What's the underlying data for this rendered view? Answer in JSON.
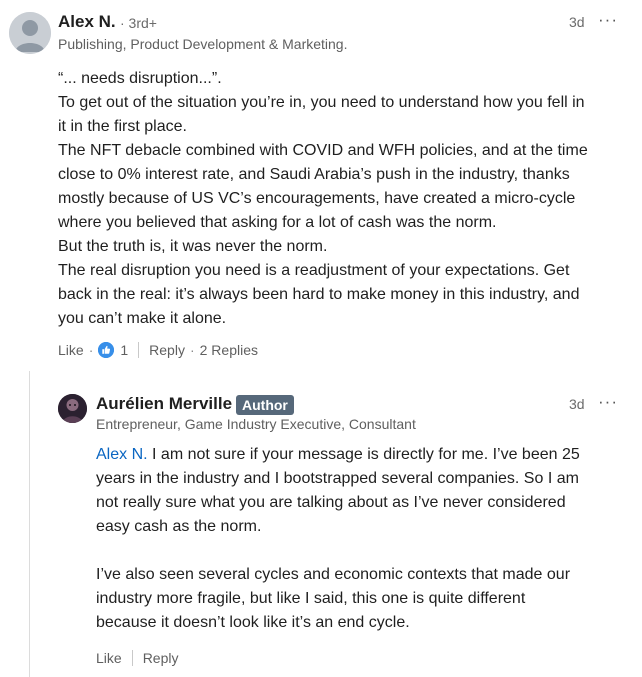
{
  "comment": {
    "author": "Alex N.",
    "degree": "· 3rd+",
    "headline": "Publishing, Product Development & Marketing.",
    "time": "3d",
    "more_icon": "···",
    "body_lines": [
      "“... needs disruption...”.",
      "To get out of the situation you’re in, you need to understand how you fell in",
      "it in the first place.",
      "The NFT debacle combined with COVID and WFH policies, and at the time",
      "close to 0% interest rate, and Saudi Arabia’s push in the industry, thanks",
      "mostly because of US VC’s encouragements, have created a micro-cycle",
      "where you believed that asking for a lot of cash was the norm.",
      "But the truth is, it was never the norm.",
      "The real disruption you need is a readjustment of your expectations. Get",
      "back in the real: it’s always been hard to make money in this industry, and",
      "you can’t make it alone."
    ],
    "actions": {
      "like_label": "Like",
      "separator": "·",
      "reaction_count": "1",
      "reply_label": "Reply",
      "replies_label": "2 Replies"
    },
    "colors": {
      "like_badge": "#378fe9"
    }
  },
  "reply": {
    "author": "Aurélien Merville",
    "badge": "Author",
    "headline": "Entrepreneur, Game Industry Executive, Consultant",
    "time": "3d",
    "more_icon": "···",
    "mention": "Alex N.",
    "para1_first_rest": " I am not sure if your message is directly for me. I’ve been 25",
    "para1_lines": [
      "years in the industry and I bootstrapped several companies. So I am",
      "not really sure what you are talking about as I’ve never considered",
      "easy cash as the norm."
    ],
    "para2_lines": [
      "I’ve also seen several cycles and economic contexts that made our",
      "industry more fragile, but like I said, this one is quite different",
      "because it doesn’t look like it’s an end cycle."
    ],
    "actions": {
      "like_label": "Like",
      "reply_label": "Reply"
    },
    "colors": {
      "mention": "#0a66c2",
      "badge_bg": "#56687a"
    }
  }
}
